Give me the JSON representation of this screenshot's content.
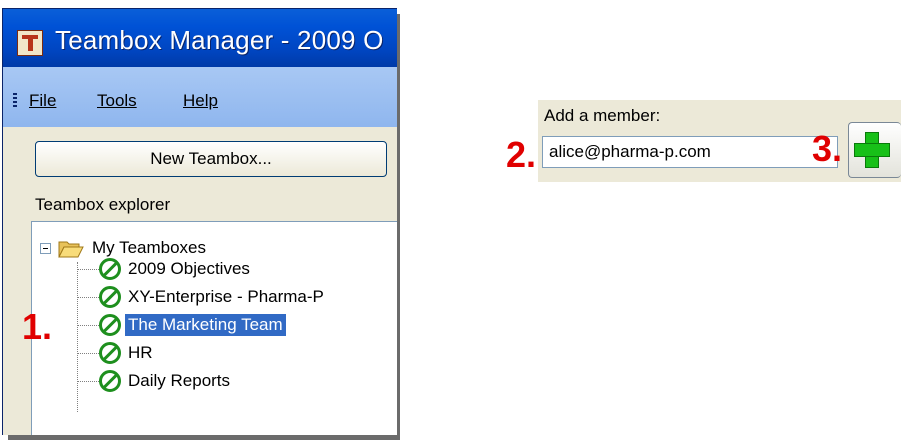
{
  "window": {
    "title": "Teambox Manager - 2009 O",
    "menu": [
      {
        "label": "File"
      },
      {
        "label": "Tools"
      },
      {
        "label": "Help"
      }
    ],
    "new_teambox_label": "New Teambox...",
    "explorer_label": "Teambox explorer",
    "tree": {
      "root_label": "My Teamboxes",
      "items": [
        {
          "label": "2009 Objectives",
          "selected": false
        },
        {
          "label": "XY-Enterprise - Pharma-P",
          "selected": false
        },
        {
          "label": "The Marketing Team",
          "selected": true
        },
        {
          "label": "HR",
          "selected": false
        },
        {
          "label": "Daily Reports",
          "selected": false
        }
      ]
    }
  },
  "add_member": {
    "label": "Add a member:",
    "value": "alice@pharma-p.com"
  },
  "step_numbers": [
    "1.",
    "2.",
    "3."
  ],
  "colors": {
    "titlebar": "#0052d6",
    "menubar": "#9cc0f2",
    "selection": "#316ac5",
    "step_number": "#e00000",
    "no_entry_icon": "#1e8f1e",
    "plus_icon": "#18c018"
  },
  "icons": [
    "teambox-app-icon",
    "folder-open-icon",
    "no-entry-icon",
    "green-plus-icon",
    "minus-expander-icon"
  ]
}
